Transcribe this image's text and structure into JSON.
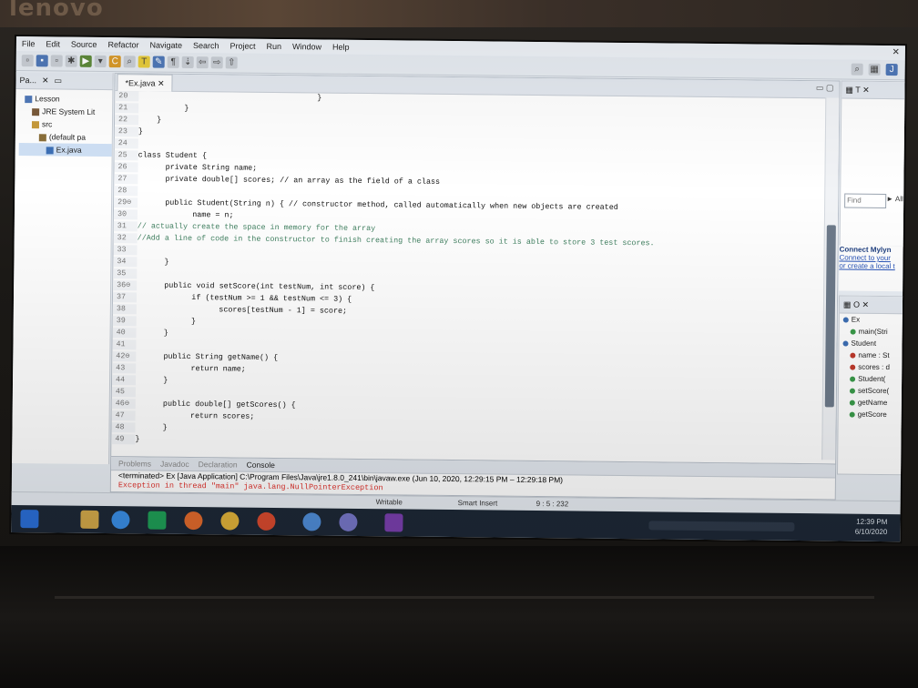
{
  "menu": [
    "File",
    "Edit",
    "Source",
    "Refactor",
    "Navigate",
    "Search",
    "Project",
    "Run",
    "Window",
    "Help"
  ],
  "window_close": "✕",
  "package_explorer": {
    "title": "Pa...",
    "tree": [
      "Lesson",
      "JRE System Lit",
      "src",
      "(default pa",
      "Ex.java"
    ]
  },
  "editor": {
    "tab": "*Ex.java",
    "lines": [
      {
        "n": "20",
        "t": "                                       }"
      },
      {
        "n": "21",
        "t": "          }"
      },
      {
        "n": "22",
        "t": "    }"
      },
      {
        "n": "23",
        "t": "}"
      },
      {
        "n": "24",
        "t": ""
      },
      {
        "n": "25",
        "t": "class Student {"
      },
      {
        "n": "26",
        "t": "      private String name;"
      },
      {
        "n": "27",
        "t": "      private double[] scores; // an array as the field of a class"
      },
      {
        "n": "28",
        "t": ""
      },
      {
        "n": "29⊖",
        "t": "      public Student(String n) { // constructor method, called automatically when new objects are created"
      },
      {
        "n": "30",
        "t": "            name = n;"
      },
      {
        "n": "31",
        "t": "// actually create the space in memory for the array"
      },
      {
        "n": "32",
        "t": "//Add a line of code in the constructor to finish creating the array scores so it is able to store 3 test scores."
      },
      {
        "n": "33",
        "t": ""
      },
      {
        "n": "34",
        "t": "      }"
      },
      {
        "n": "35",
        "t": ""
      },
      {
        "n": "36⊖",
        "t": "      public void setScore(int testNum, int score) {"
      },
      {
        "n": "37",
        "t": "            if (testNum >= 1 && testNum <= 3) {"
      },
      {
        "n": "38",
        "t": "                  scores[testNum - 1] = score;"
      },
      {
        "n": "39",
        "t": "            }"
      },
      {
        "n": "40",
        "t": "      }"
      },
      {
        "n": "41",
        "t": ""
      },
      {
        "n": "42⊖",
        "t": "      public String getName() {"
      },
      {
        "n": "43",
        "t": "            return name;"
      },
      {
        "n": "44",
        "t": "      }"
      },
      {
        "n": "45",
        "t": ""
      },
      {
        "n": "46⊖",
        "t": "      public double[] getScores() {"
      },
      {
        "n": "47",
        "t": "            return scores;"
      },
      {
        "n": "48",
        "t": "      }"
      },
      {
        "n": "49",
        "t": "}"
      }
    ]
  },
  "find": {
    "placeholder": "Find",
    "all": "► All"
  },
  "mylyn": {
    "title": "Connect Mylyn",
    "line1": "Connect to your",
    "line2": "or create a local t"
  },
  "outline": [
    "Ex",
    "main(Stri",
    "Student",
    "name : St",
    "scores : d",
    "Student(",
    "setScore(",
    "getName",
    "getScore"
  ],
  "console": {
    "tabs": [
      "Problems",
      "Javadoc",
      "Declaration",
      "Console"
    ],
    "terminated": "<terminated> Ex [Java Application] C:\\Program Files\\Java\\jre1.8.0_241\\bin\\javaw.exe (Jun 10, 2020, 12:29:15 PM – 12:29:18 PM)",
    "error": "Exception in thread \"main\" java.lang.NullPointerException"
  },
  "status": {
    "writable": "Writable",
    "insert": "Smart Insert",
    "position": "9 : 5 : 232"
  },
  "clock": {
    "time": "12:39 PM",
    "date": "6/10/2020"
  },
  "brand": "lenovo"
}
